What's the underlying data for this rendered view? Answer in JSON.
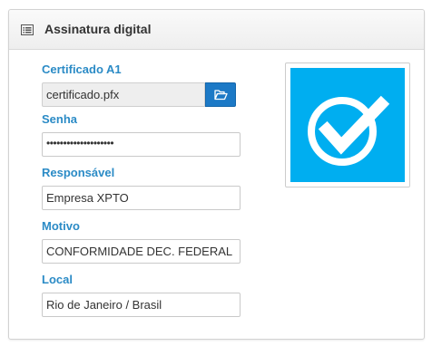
{
  "panel": {
    "title": "Assinatura digital",
    "icon": "list-card-icon"
  },
  "fields": {
    "certificate": {
      "label": "Certificado A1",
      "value": "certificado.pfx",
      "browse_icon": "folder-open-icon"
    },
    "password": {
      "label": "Senha",
      "value": "••••••••••••••••••••"
    },
    "responsible": {
      "label": "Responsável",
      "value": "Empresa XPTO"
    },
    "reason": {
      "label": "Motivo",
      "value": "CONFORMIDADE DEC. FEDERAL"
    },
    "location": {
      "label": "Local",
      "value": "Rio de Janeiro / Brasil"
    }
  },
  "signature_image": {
    "icon": "check-circle-icon",
    "background": "#00aef0"
  },
  "colors": {
    "label": "#2b8bc6",
    "button": "#1c79c6"
  }
}
